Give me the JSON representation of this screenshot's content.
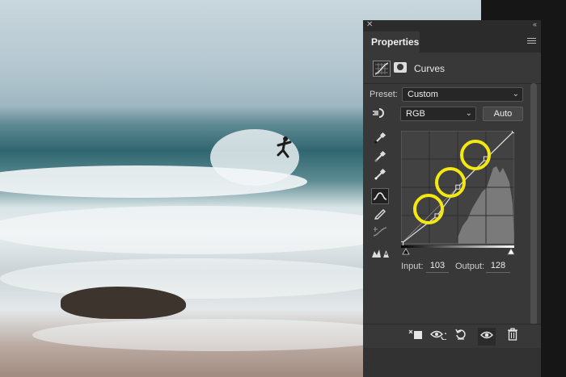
{
  "panel": {
    "tab_label": "Properties",
    "title": "Curves",
    "preset_label": "Preset:",
    "preset_value": "Custom",
    "channel_value": "RGB",
    "auto_label": "Auto",
    "input_label": "Input:",
    "input_value": "103",
    "output_label": "Output:",
    "output_value": "128"
  },
  "icons": {
    "close": "close-icon",
    "collapse": "collapse-arrows-icon",
    "menu": "panel-menu-icon",
    "adjustment_layer": "curves-adjustment-icon",
    "mask": "layer-mask-icon",
    "on_image": "on-image-adjustment-icon",
    "sample_black": "black-point-eyedropper-icon",
    "sample_gray": "gray-point-eyedropper-icon",
    "sample_white": "white-point-eyedropper-icon",
    "edit_points": "edit-points-curve-icon",
    "draw": "pencil-draw-icon",
    "smooth": "smooth-curve-icon",
    "clipping": "clipping-warning-icon",
    "clip_to_layer": "clip-to-layer-icon",
    "view_previous": "view-previous-state-icon",
    "reset": "reset-icon",
    "visibility": "eye-visibility-icon",
    "delete": "trash-icon"
  },
  "colors": {
    "panel_bg": "#383838",
    "highlight_ring": "#f4e810"
  },
  "curve": {
    "points": [
      [
        0,
        0
      ],
      [
        81,
        63
      ],
      [
        128,
        128
      ],
      [
        191,
        192
      ],
      [
        255,
        255
      ]
    ],
    "selected_input": 103,
    "selected_output": 128
  }
}
